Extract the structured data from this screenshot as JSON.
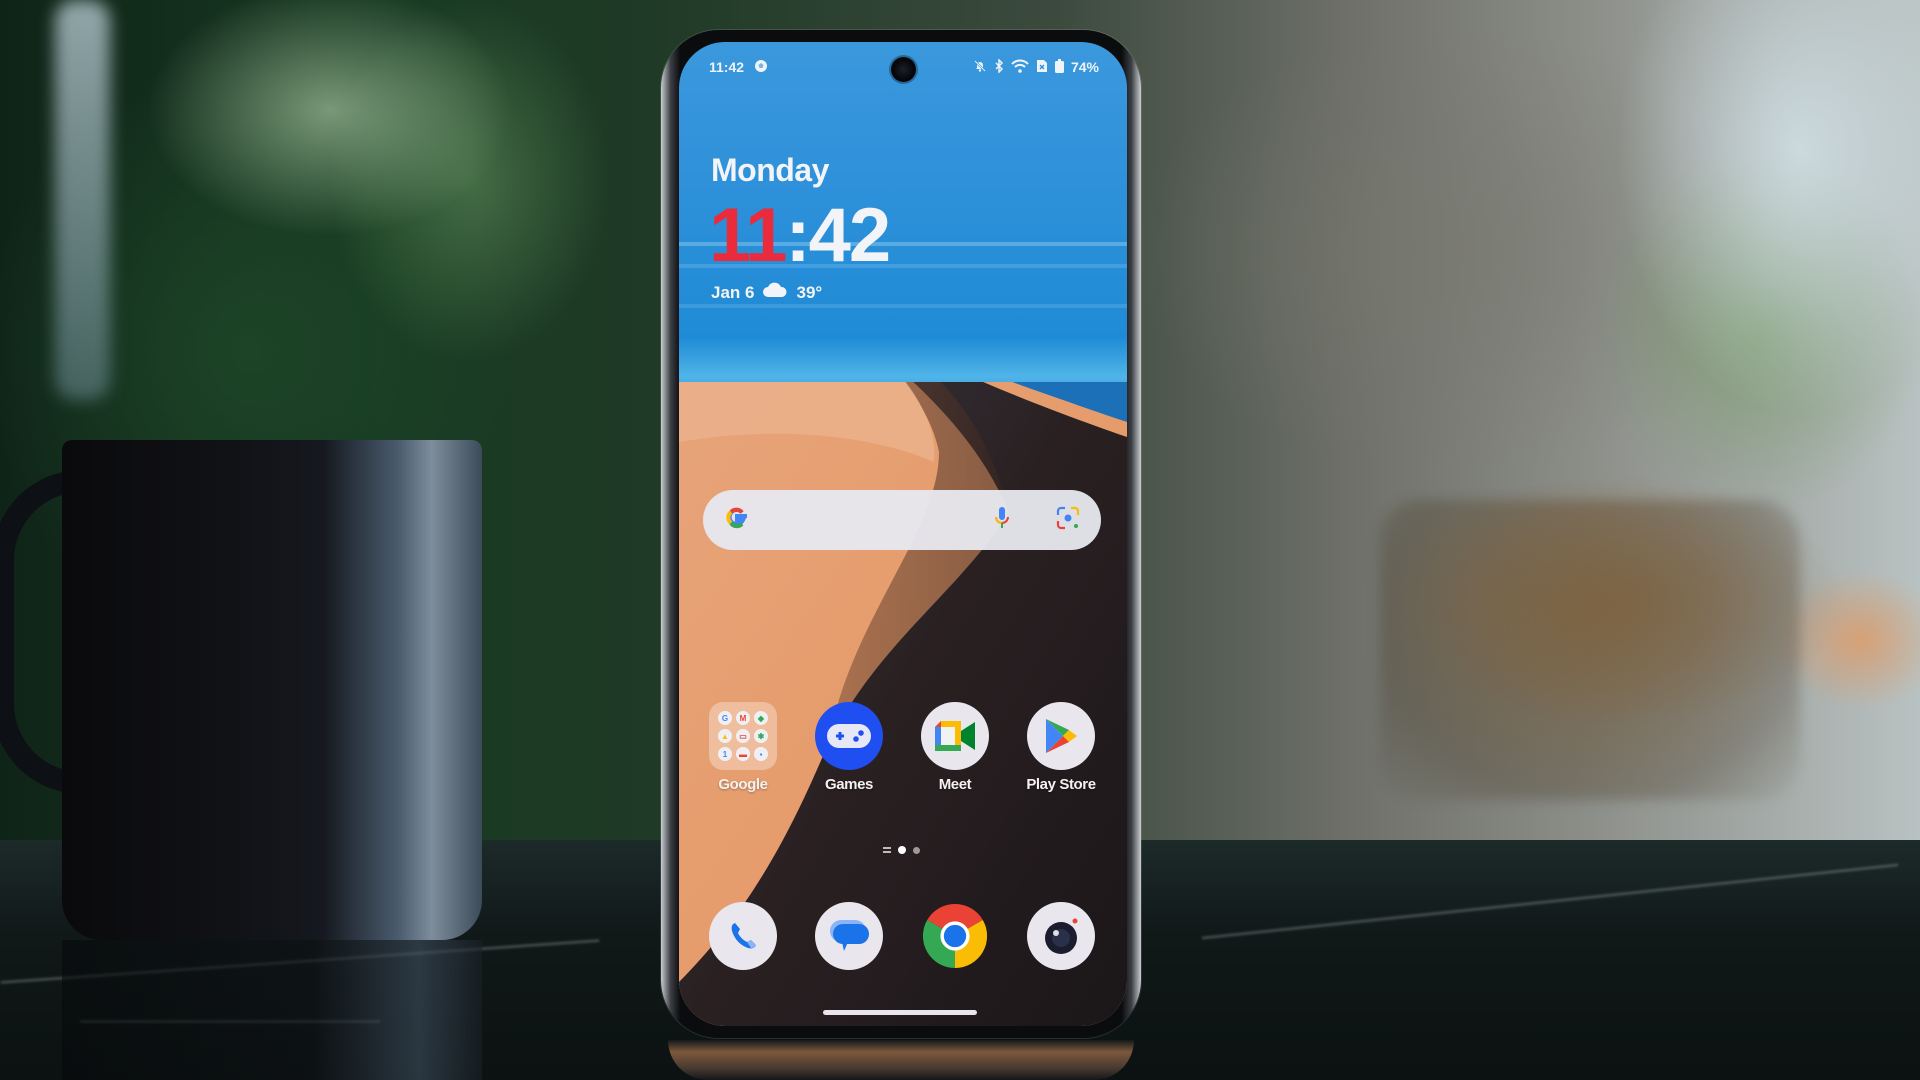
{
  "status_bar": {
    "time": "11:42",
    "left_icons": [
      "soccer-ball-icon"
    ],
    "right_icons": [
      "bell-off-icon",
      "bluetooth-icon",
      "wifi-icon",
      "no-sim-icon",
      "battery-icon"
    ],
    "battery": "74%"
  },
  "clock_widget": {
    "day": "Monday",
    "hours": "11",
    "separator": ":",
    "minutes": "42",
    "date": "Jan 6",
    "weather_icon": "cloud-icon",
    "temperature": "39°"
  },
  "search_bar": {
    "logo": "google-g-icon",
    "voice": "microphone-icon",
    "lens": "google-lens-icon"
  },
  "apps": [
    {
      "label": "Google",
      "icon": "google-folder-icon",
      "type": "folder"
    },
    {
      "label": "Games",
      "icon": "gamepad-icon"
    },
    {
      "label": "Meet",
      "icon": "meet-icon"
    },
    {
      "label": "Play Store",
      "icon": "play-store-icon"
    }
  ],
  "page_indicator": {
    "pages": 2,
    "active": 1
  },
  "dock": [
    {
      "name": "Phone",
      "icon": "phone-icon"
    },
    {
      "name": "Messages",
      "icon": "messages-icon"
    },
    {
      "name": "Chrome",
      "icon": "chrome-icon"
    },
    {
      "name": "Camera",
      "icon": "camera-icon"
    }
  ],
  "colors": {
    "clock_accent": "#ea2b3b",
    "games_blue": "#1f4ff0"
  }
}
